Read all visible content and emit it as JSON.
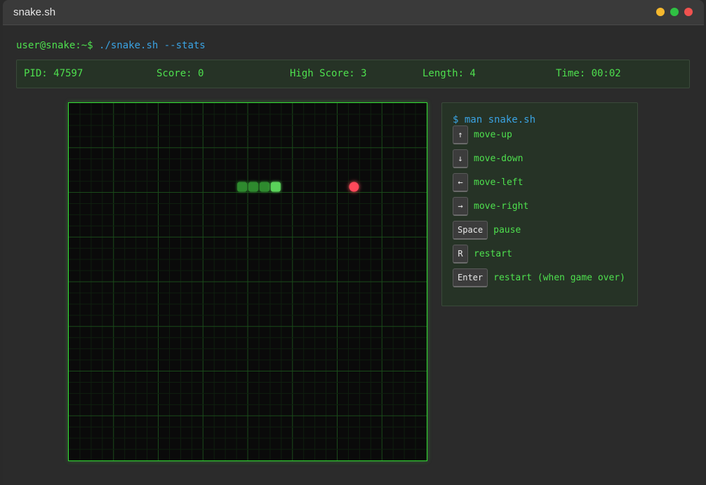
{
  "window": {
    "title": "snake.sh",
    "controls": [
      {
        "name": "minimize",
        "color": "#f5b82e"
      },
      {
        "name": "maximize",
        "color": "#2fc043"
      },
      {
        "name": "close",
        "color": "#f0524f"
      }
    ]
  },
  "terminal": {
    "prompt": "user@snake:~$",
    "command": "./snake.sh --stats"
  },
  "stats": {
    "pid": "PID: 47597",
    "score": "Score: 0",
    "high_score": "High Score: 3",
    "length": "Length: 4",
    "time": "Time: 00:02"
  },
  "game": {
    "grid_cols": 32,
    "grid_rows": 32,
    "snake": [
      [
        15,
        7
      ],
      [
        16,
        7
      ],
      [
        17,
        7
      ],
      [
        18,
        7
      ]
    ],
    "snake_head_index": 3,
    "food": [
      25,
      7
    ],
    "colors": {
      "board_bg": "#0a0a0a",
      "grid_minor": "#0f1f0f",
      "grid_major": "#1a4a1a",
      "snake_body": "#2d8a2d",
      "snake_head": "#5ad35a",
      "food": "#ff4a5a",
      "border": "#33dd33"
    }
  },
  "help": {
    "title": "$ man snake.sh",
    "keys": [
      {
        "key": "↑",
        "desc": "move-up",
        "icon": "arrow-up-key"
      },
      {
        "key": "↓",
        "desc": "move-down",
        "icon": "arrow-down-key"
      },
      {
        "key": "←",
        "desc": "move-left",
        "icon": "arrow-left-key"
      },
      {
        "key": "→",
        "desc": "move-right",
        "icon": "arrow-right-key"
      },
      {
        "key": "Space",
        "desc": "pause",
        "icon": "space-key"
      },
      {
        "key": "R",
        "desc": "restart",
        "icon": "r-key"
      },
      {
        "key": "Enter",
        "desc": "restart (when game over)",
        "icon": "enter-key"
      }
    ]
  }
}
